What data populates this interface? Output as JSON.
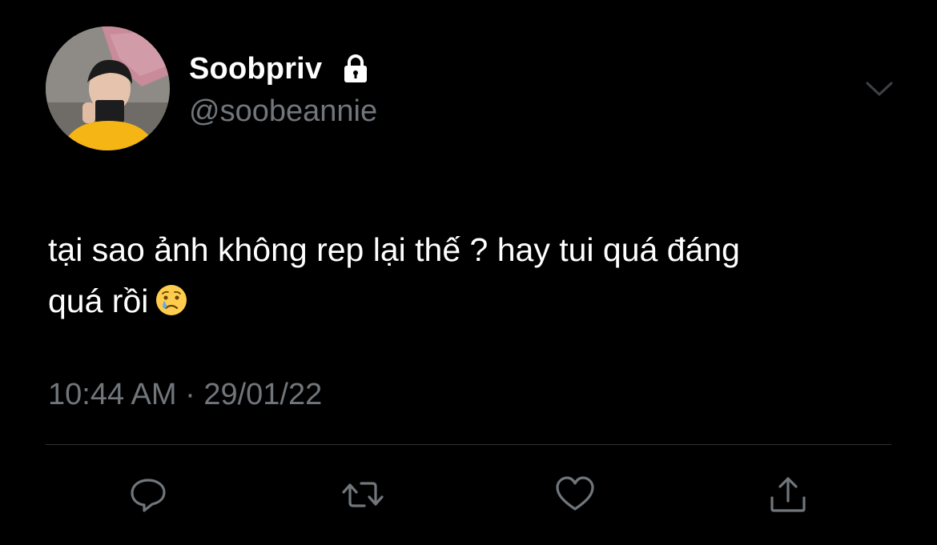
{
  "user": {
    "display_name": "Soobpriv",
    "handle": "@soobeannie",
    "protected_icon": "lock-icon",
    "avatar": "profile-photo"
  },
  "tweet": {
    "line1": "tại sao ảnh không rep lại thế ? hay tui quá đáng",
    "line2": "quá rồi",
    "emoji": "crying-face-emoji"
  },
  "meta": {
    "time": "10:44 AM",
    "separator": " · ",
    "date": "29/01/22"
  },
  "actions": [
    {
      "name": "reply",
      "icon": "comment-icon"
    },
    {
      "name": "retweet",
      "icon": "retweet-icon"
    },
    {
      "name": "like",
      "icon": "heart-icon"
    },
    {
      "name": "share",
      "icon": "share-icon"
    }
  ],
  "colors": {
    "background": "#000000",
    "primary_text": "#ffffff",
    "secondary_text": "#71767b",
    "divider": "#2f3336",
    "icon": "#71767b"
  }
}
